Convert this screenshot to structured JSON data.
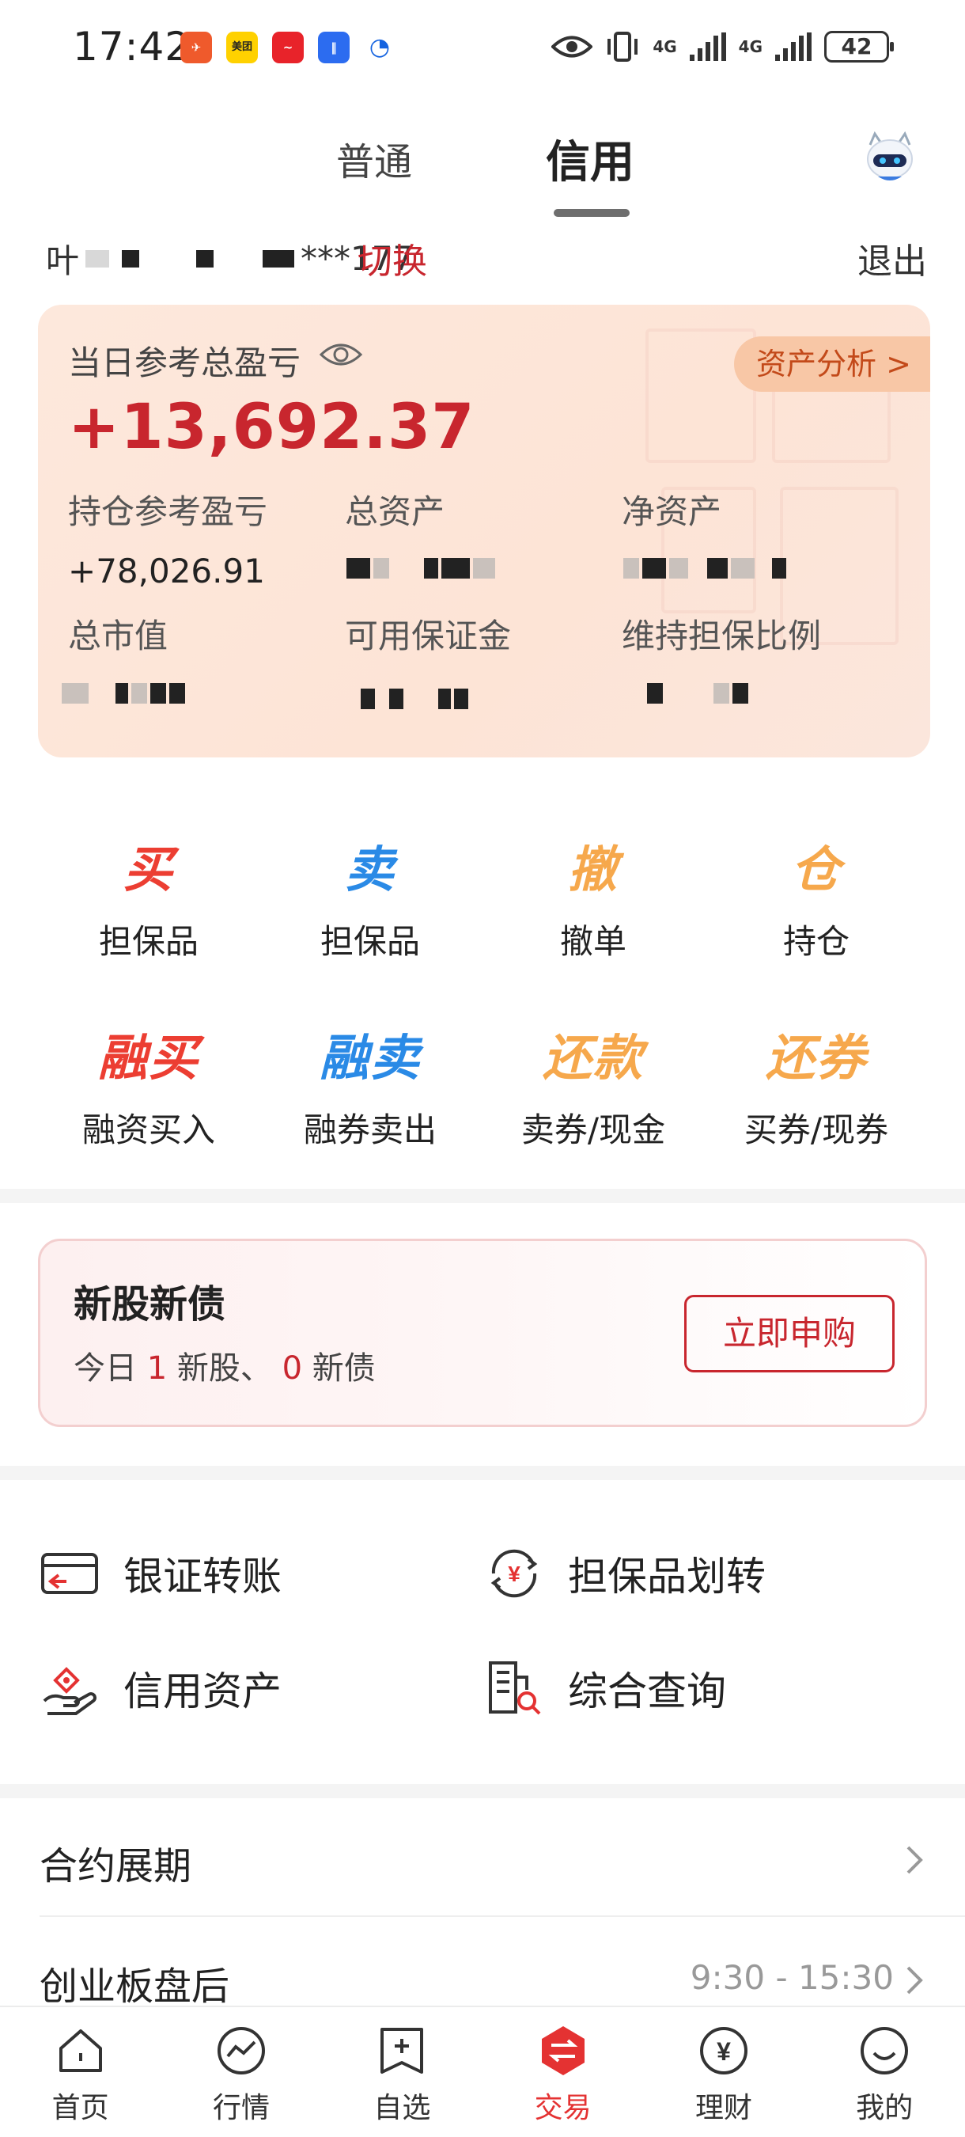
{
  "status_bar": {
    "time": "17:42",
    "app_icons": [
      "bell-app-icon",
      "meituan-app-icon",
      "stock-app-icon",
      "voice-app-icon",
      "bank-app-icon"
    ],
    "meituan_label": "美团",
    "signal_labels": [
      "4G",
      "4G"
    ],
    "battery": "42"
  },
  "header": {
    "tabs": [
      {
        "label": "普通",
        "active": false
      },
      {
        "label": "信用",
        "active": true
      }
    ],
    "assistant_icon": "robot-assistant-icon"
  },
  "account": {
    "name_prefix": "叶",
    "masked_suffix": "***177",
    "switch_label": "切换",
    "logout_label": "退出"
  },
  "asset_card": {
    "daily_pl_label": "当日参考总盈亏",
    "daily_pl_value": "+13,692.37",
    "analysis_button": "资产分析 >",
    "position_pl_label": "持仓参考盈亏",
    "position_pl_value": "+78,026.91",
    "total_assets_label": "总资产",
    "net_assets_label": "净资产",
    "market_value_label": "总市值",
    "available_margin_label": "可用保证金",
    "maintenance_ratio_label": "维持担保比例"
  },
  "actions": [
    {
      "icon_text": "买",
      "label": "担保品",
      "color": "#ec3e32"
    },
    {
      "icon_text": "卖",
      "label": "担保品",
      "color": "#2a8ae6"
    },
    {
      "icon_text": "撤",
      "label": "撤单",
      "color": "#f6a84c"
    },
    {
      "icon_text": "仓",
      "label": "持仓",
      "color": "#f6a84c"
    },
    {
      "icon_text": "融买",
      "label": "融资买入",
      "color": "#ec3e32"
    },
    {
      "icon_text": "融卖",
      "label": "融券卖出",
      "color": "#2a8ae6"
    },
    {
      "icon_text": "还款",
      "label": "卖券/现金",
      "color": "#f6a84c"
    },
    {
      "icon_text": "还券",
      "label": "买券/现券",
      "color": "#f6a84c"
    }
  ],
  "ipo": {
    "title": "新股新债",
    "text_today": "今日",
    "stock_count": "1",
    "text_stock": "新股、",
    "bond_count": "0",
    "text_bond": "新债",
    "button": "立即申购"
  },
  "services": [
    {
      "label": "银证转账",
      "icon": "bank-card-icon"
    },
    {
      "label": "担保品划转",
      "icon": "yuan-transfer-icon"
    },
    {
      "label": "信用资产",
      "icon": "hand-asset-icon"
    },
    {
      "label": "综合查询",
      "icon": "building-search-icon"
    }
  ],
  "list": [
    {
      "title": "合约展期",
      "right": ""
    },
    {
      "title": "创业板盘后",
      "right": "9:30 - 15:30"
    }
  ],
  "nav": [
    {
      "label": "首页",
      "icon": "home-icon",
      "active": false
    },
    {
      "label": "行情",
      "icon": "market-icon",
      "active": false
    },
    {
      "label": "自选",
      "icon": "watchlist-icon",
      "active": false
    },
    {
      "label": "交易",
      "icon": "trade-icon",
      "active": true
    },
    {
      "label": "理财",
      "icon": "wealth-icon",
      "active": false
    },
    {
      "label": "我的",
      "icon": "profile-icon",
      "active": false
    }
  ],
  "colors": {
    "brand_red": "#c8262e",
    "buy_red": "#ec3e32",
    "sell_blue": "#2a8ae6",
    "accent_orange": "#f6a84c",
    "card_bg": "#fde8dc"
  }
}
